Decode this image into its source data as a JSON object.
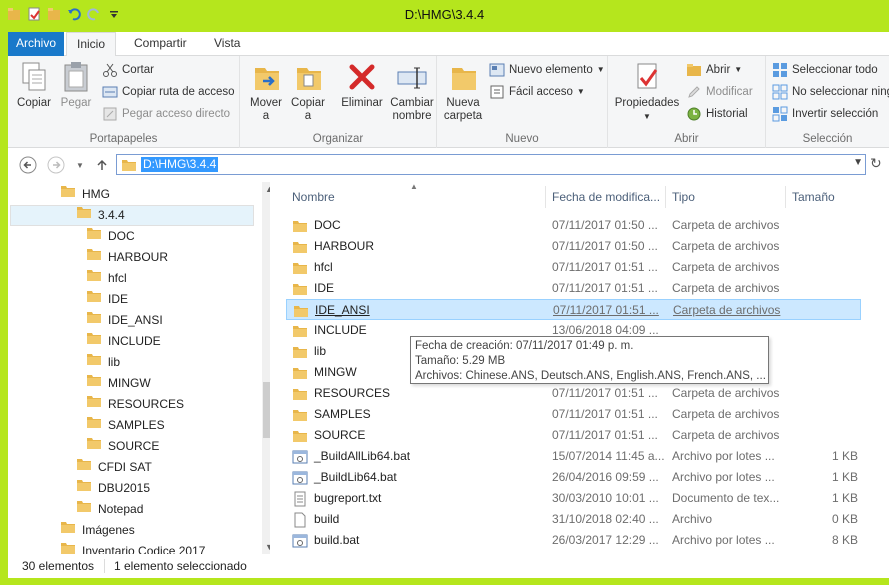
{
  "window": {
    "title": "D:\\HMG\\3.4.4",
    "frame_color": "#b5e61d"
  },
  "tabs": [
    {
      "label": "Archivo"
    },
    {
      "label": "Inicio"
    },
    {
      "label": "Compartir"
    },
    {
      "label": "Vista"
    }
  ],
  "ribbon": {
    "portapapeles": {
      "label": "Portapapeles",
      "copy": "Copiar",
      "paste": "Pegar",
      "cut": "Cortar",
      "copy_path": "Copiar ruta de acceso",
      "paste_shortcut": "Pegar acceso directo"
    },
    "organizar": {
      "label": "Organizar",
      "move_to_1": "Mover",
      "move_to_2": "a",
      "copy_to_1": "Copiar",
      "copy_to_2": "a",
      "delete": "Eliminar",
      "rename_1": "Cambiar",
      "rename_2": "nombre"
    },
    "nuevo": {
      "label": "Nuevo",
      "new_folder_1": "Nueva",
      "new_folder_2": "carpeta",
      "new_item": "Nuevo elemento",
      "easy_access": "Fácil acceso"
    },
    "abrir": {
      "label": "Abrir",
      "properties": "Propiedades",
      "open": "Abrir",
      "edit": "Modificar",
      "history": "Historial"
    },
    "seleccion": {
      "label": "Selección",
      "select_all": "Seleccionar todo",
      "select_none": "No seleccionar ninguno",
      "invert": "Invertir selección"
    }
  },
  "address": {
    "path": "D:\\HMG\\3.4.4"
  },
  "tree": [
    {
      "label": "HMG",
      "level": 0
    },
    {
      "label": "3.4.4",
      "level": 1,
      "selected": true
    },
    {
      "label": "DOC",
      "level": 2
    },
    {
      "label": "HARBOUR",
      "level": 2
    },
    {
      "label": "hfcl",
      "level": 2
    },
    {
      "label": "IDE",
      "level": 2
    },
    {
      "label": "IDE_ANSI",
      "level": 2
    },
    {
      "label": "INCLUDE",
      "level": 2
    },
    {
      "label": "lib",
      "level": 2
    },
    {
      "label": "MINGW",
      "level": 2
    },
    {
      "label": "RESOURCES",
      "level": 2
    },
    {
      "label": "SAMPLES",
      "level": 2
    },
    {
      "label": "SOURCE",
      "level": 2
    },
    {
      "label": "CFDI SAT",
      "level": 1
    },
    {
      "label": "DBU2015",
      "level": 1
    },
    {
      "label": "Notepad",
      "level": 1
    },
    {
      "label": "Imágenes",
      "level": 0
    },
    {
      "label": "Inventario Codice 2017",
      "level": 0
    }
  ],
  "columns": {
    "name": "Nombre",
    "date": "Fecha de modifica...",
    "type": "Tipo",
    "size": "Tamaño"
  },
  "files": [
    {
      "name": "DOC",
      "date": "07/11/2017 01:50 ...",
      "type": "Carpeta de archivos",
      "size": "",
      "icon": "folder"
    },
    {
      "name": "HARBOUR",
      "date": "07/11/2017 01:50 ...",
      "type": "Carpeta de archivos",
      "size": "",
      "icon": "folder"
    },
    {
      "name": "hfcl",
      "date": "07/11/2017 01:51 ...",
      "type": "Carpeta de archivos",
      "size": "",
      "icon": "folder"
    },
    {
      "name": "IDE",
      "date": "07/11/2017 01:51 ...",
      "type": "Carpeta de archivos",
      "size": "",
      "icon": "folder"
    },
    {
      "name": "IDE_ANSI",
      "date": "07/11/2017 01:51 ...",
      "type": "Carpeta de archivos",
      "size": "",
      "icon": "folder",
      "selected": true
    },
    {
      "name": "INCLUDE",
      "date": "13/06/2018 04:09 ...",
      "type": "",
      "size": "",
      "icon": "folder"
    },
    {
      "name": "lib",
      "date": "",
      "type": "",
      "size": "",
      "icon": "folder"
    },
    {
      "name": "MINGW",
      "date": "",
      "type": "",
      "size": "",
      "icon": "folder"
    },
    {
      "name": "RESOURCES",
      "date": "07/11/2017 01:51 ...",
      "type": "Carpeta de archivos",
      "size": "",
      "icon": "folder"
    },
    {
      "name": "SAMPLES",
      "date": "07/11/2017 01:51 ...",
      "type": "Carpeta de archivos",
      "size": "",
      "icon": "folder"
    },
    {
      "name": "SOURCE",
      "date": "07/11/2017 01:51 ...",
      "type": "Carpeta de archivos",
      "size": "",
      "icon": "folder"
    },
    {
      "name": "_BuildAllLib64.bat",
      "date": "15/07/2014 11:45 a...",
      "type": "Archivo por lotes ...",
      "size": "1 KB",
      "icon": "bat"
    },
    {
      "name": "_BuildLib64.bat",
      "date": "26/04/2016 09:59 ...",
      "type": "Archivo por lotes ...",
      "size": "1 KB",
      "icon": "bat"
    },
    {
      "name": "bugreport.txt",
      "date": "30/03/2010 10:01 ...",
      "type": "Documento de tex...",
      "size": "1 KB",
      "icon": "txt"
    },
    {
      "name": "build",
      "date": "31/10/2018 02:40 ...",
      "type": "Archivo",
      "size": "0 KB",
      "icon": "file"
    },
    {
      "name": "build.bat",
      "date": "26/03/2017 12:29 ...",
      "type": "Archivo por lotes ...",
      "size": "8 KB",
      "icon": "bat"
    }
  ],
  "tooltip": {
    "line1": "Fecha de creación: 07/11/2017 01:49 p. m.",
    "line2": "Tamaño: 5.29 MB",
    "line3": "Archivos: Chinese.ANS, Deutsch.ANS, English.ANS, French.ANS, ..."
  },
  "status": {
    "count": "30 elementos",
    "selected": "1 elemento seleccionado"
  }
}
